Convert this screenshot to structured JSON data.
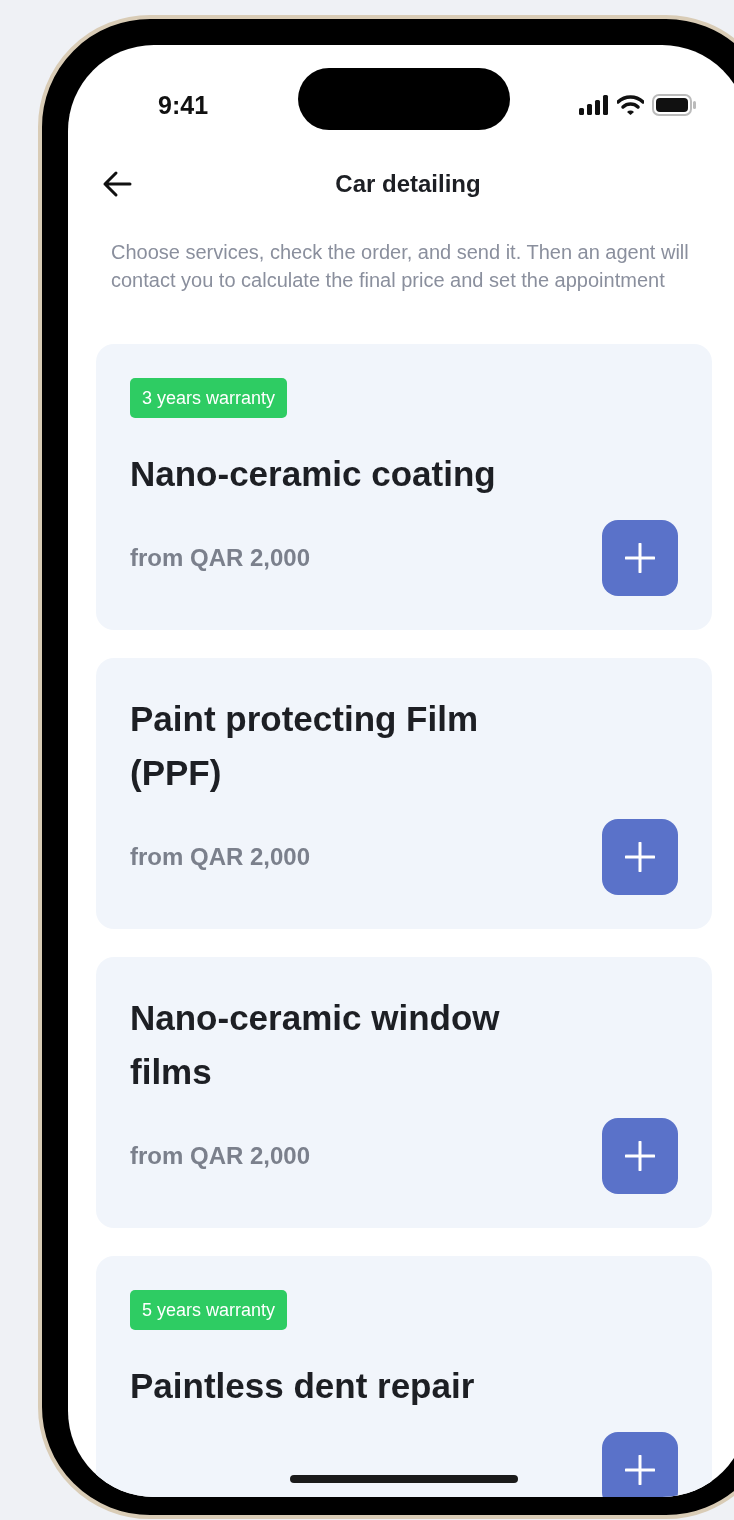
{
  "status_bar": {
    "time": "9:41"
  },
  "header": {
    "title": "Car detailing"
  },
  "intro": "Choose services, check the order, and send it. Then an agent will contact you to calculate the final price and set the appointment",
  "services": [
    {
      "badge": "3 years warranty",
      "title": "Nano-ceramic coating",
      "price": "from QAR 2,000"
    },
    {
      "title": "Paint protecting Film (PPF)",
      "price": "from QAR 2,000"
    },
    {
      "title": "Nano-ceramic window films",
      "price": "from QAR 2,000"
    },
    {
      "badge": "5 years warranty",
      "title": "Paintless dent repair"
    }
  ]
}
